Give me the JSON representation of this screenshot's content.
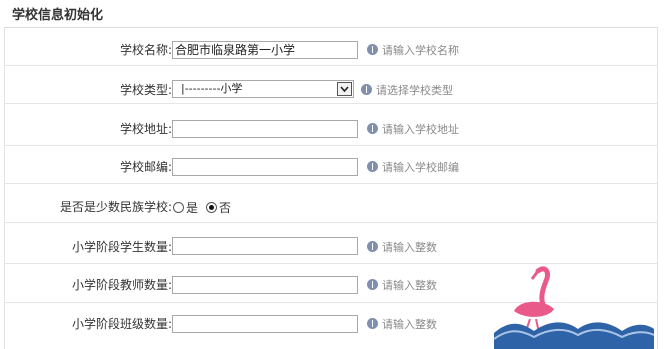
{
  "page": {
    "title": "学校信息初始化"
  },
  "form": {
    "school_name": {
      "label": "学校名称:",
      "value": "合肥市临泉路第一小学",
      "hint": "请输入学校名称"
    },
    "school_type": {
      "label": "学校类型:",
      "selected": "|---------小学",
      "hint": "请选择学校类型"
    },
    "school_address": {
      "label": "学校地址:",
      "value": "",
      "hint": "请输入学校地址"
    },
    "school_postcode": {
      "label": "学校邮编:",
      "value": "",
      "hint": "请输入学校邮编"
    },
    "minority_school": {
      "label": "是否是少数民族学校:",
      "options": [
        "是",
        "否"
      ],
      "selected": "否"
    },
    "student_count": {
      "label": "小学阶段学生数量:",
      "value": "",
      "hint": "请输入整数"
    },
    "teacher_count": {
      "label": "小学阶段教师数量:",
      "value": "",
      "hint": "请输入整数"
    },
    "class_count": {
      "label": "小学阶段班级数量:",
      "value": "",
      "hint": "请输入整数"
    }
  },
  "colors": {
    "hint_icon": "#7f8fae",
    "divider": "#e5e5e5",
    "flamingo": "#e95a8a",
    "waves": "#2f63a7"
  },
  "watermark": {
    "name": "flamingo-wave-logo"
  }
}
